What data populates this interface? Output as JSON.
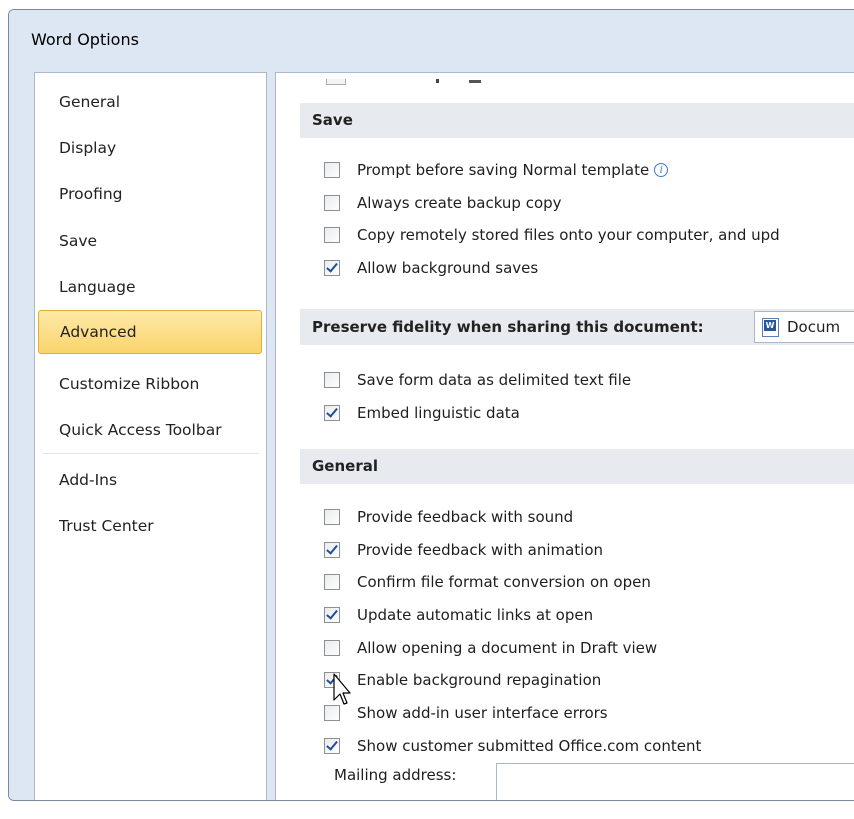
{
  "window": {
    "title": "Word Options"
  },
  "nav": {
    "items": [
      {
        "label": "General",
        "selected": false
      },
      {
        "label": "Display",
        "selected": false
      },
      {
        "label": "Proofing",
        "selected": false
      },
      {
        "label": "Save",
        "selected": false
      },
      {
        "label": "Language",
        "selected": false
      },
      {
        "label": "Advanced",
        "selected": true
      },
      {
        "label": "Customize Ribbon",
        "selected": false
      },
      {
        "label": "Quick Access Toolbar",
        "selected": false
      },
      {
        "label": "Add-Ins",
        "selected": false
      },
      {
        "label": "Trust Center",
        "selected": false
      }
    ]
  },
  "sections": {
    "save": {
      "title": "Save",
      "options": [
        {
          "label": "Prompt before saving Normal template",
          "checked": false,
          "icon": "info-icon"
        },
        {
          "label": "Always create backup copy",
          "checked": false
        },
        {
          "label": "Copy remotely stored files onto your computer, and upd",
          "checked": false
        },
        {
          "label": "Allow background saves",
          "checked": true
        }
      ]
    },
    "fidelity": {
      "title": "Preserve fidelity when sharing this document:",
      "document_select": {
        "value": "Docum",
        "icon": "word-document-icon"
      },
      "options": [
        {
          "label": "Save form data as delimited text file",
          "checked": false
        },
        {
          "label": "Embed linguistic data",
          "checked": true
        }
      ]
    },
    "general": {
      "title": "General",
      "options": [
        {
          "label": "Provide feedback with sound",
          "checked": false
        },
        {
          "label": "Provide feedback with animation",
          "checked": true
        },
        {
          "label": "Confirm file format conversion on open",
          "checked": false
        },
        {
          "label": "Update automatic links at open",
          "checked": true
        },
        {
          "label": "Allow opening a document in Draft view",
          "checked": false
        },
        {
          "label": "Enable background repagination",
          "checked": true
        },
        {
          "label": "Show add-in user interface errors",
          "checked": false
        },
        {
          "label": "Show customer submitted Office.com content",
          "checked": true
        }
      ],
      "mailing_address": {
        "label": "Mailing address:",
        "value": ""
      }
    }
  },
  "colors": {
    "frame": "#dce7f3",
    "section_header": "#e7ebf0",
    "selected_nav": "#fbd46c",
    "checkmark": "#214f9a"
  }
}
